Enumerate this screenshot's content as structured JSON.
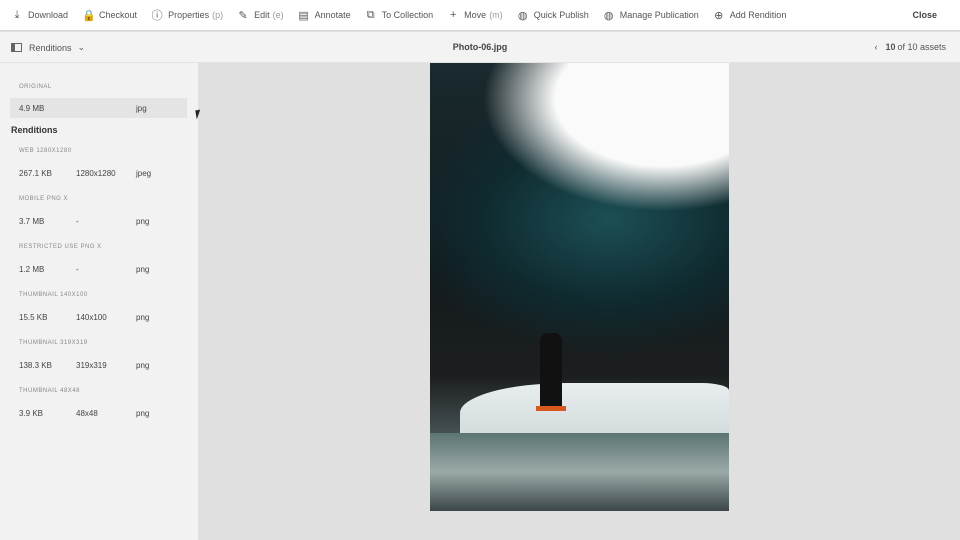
{
  "toolbar": {
    "items": [
      {
        "label": "Download",
        "icon": "download-icon",
        "glyph": "⤓"
      },
      {
        "label": "Checkout",
        "icon": "lock-icon",
        "glyph": "🔒"
      },
      {
        "label": "Properties",
        "shortcut": "(p)",
        "icon": "info-icon",
        "glyph": "ⓘ"
      },
      {
        "label": "Edit",
        "shortcut": "(e)",
        "icon": "pencil-icon",
        "glyph": "✎"
      },
      {
        "label": "Annotate",
        "icon": "annotate-icon",
        "glyph": "▤"
      },
      {
        "label": "To Collection",
        "icon": "collection-icon",
        "glyph": "⧉"
      },
      {
        "label": "Move",
        "shortcut": "(m)",
        "icon": "plus-icon",
        "glyph": "+"
      },
      {
        "label": "Quick Publish",
        "icon": "globe-icon",
        "glyph": "◍"
      },
      {
        "label": "Manage Publication",
        "icon": "globe-settings-icon",
        "glyph": "◍"
      },
      {
        "label": "Add Rendition",
        "icon": "add-circle-icon",
        "glyph": "⊕"
      }
    ],
    "close": "Close"
  },
  "subbar": {
    "rail": "Renditions",
    "title": "Photo-06.jpg",
    "pager_current": "10",
    "pager_rest": "of 10 assets"
  },
  "sidebar": {
    "original_label": "ORIGINAL",
    "original": {
      "size": "4.9 MB",
      "dims": "",
      "type": "jpg"
    },
    "heading": "Renditions",
    "renditions": [
      {
        "name": "WEB 1280X1280",
        "size": "267.1 KB",
        "dims": "1280x1280",
        "type": "jpeg"
      },
      {
        "name": "MOBILE PNG X",
        "size": "3.7 MB",
        "dims": "-",
        "type": "png"
      },
      {
        "name": "RESTRICTED USE PNG X",
        "size": "1.2 MB",
        "dims": "-",
        "type": "png"
      },
      {
        "name": "THUMBNAIL 140X100",
        "size": "15.5 KB",
        "dims": "140x100",
        "type": "png"
      },
      {
        "name": "THUMBNAIL 319X319",
        "size": "138.3 KB",
        "dims": "319x319",
        "type": "png"
      },
      {
        "name": "THUMBNAIL 48X48",
        "size": "3.9 KB",
        "dims": "48x48",
        "type": "png"
      }
    ]
  }
}
